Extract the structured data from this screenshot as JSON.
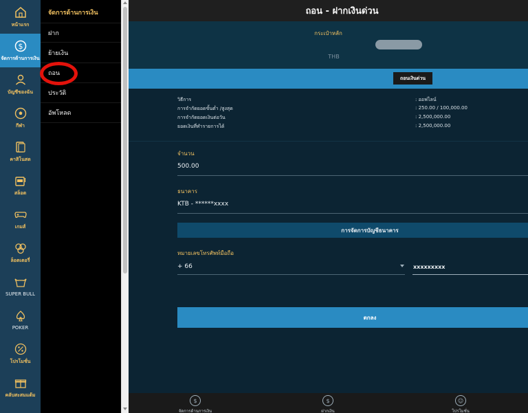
{
  "rail": {
    "items": [
      {
        "label": "หน้าแรก",
        "icon": "home-icon"
      },
      {
        "label": "จัดการด้านการเงิน",
        "icon": "dollar-circle-icon"
      },
      {
        "label": "บัญชีของฉัน",
        "icon": "user-icon"
      },
      {
        "label": "กีฬา",
        "icon": "soccer-ball-icon"
      },
      {
        "label": "คาสิโนสด",
        "icon": "cards-icon"
      },
      {
        "label": "สล็อต",
        "icon": "slot-machine-icon"
      },
      {
        "label": "เกมส์",
        "icon": "gamepad-icon"
      },
      {
        "label": "ล็อตเตอรี่",
        "icon": "lottery-balls-icon"
      },
      {
        "label": "SUPER BULL",
        "icon": "bull-icon"
      },
      {
        "label": "POKER",
        "icon": "spade-icon"
      },
      {
        "label": "โปรโมชั่น",
        "icon": "percent-icon"
      },
      {
        "label": "คลับสะสมแต้ม",
        "icon": "gift-icon"
      }
    ]
  },
  "submenu": {
    "title": "จัดการด้านการเงิน",
    "items": [
      "ฝาก",
      "ย้ายเงิน",
      "ถอน",
      "ประวัติ",
      "อัพโหลด"
    ]
  },
  "header": {
    "title": "ถอน - ฝากเงินด่วน"
  },
  "wallet": {
    "title": "กระเป๋าหลัก",
    "currency": "THB"
  },
  "instant_button": "ถอนเงินด่วน",
  "info": {
    "rows": [
      {
        "key": "วิธีการ",
        "value": ": ออฟไลน์"
      },
      {
        "key": "การจำกัดยอดขั้นต่ำ /สูงสุด",
        "value": ": 250.00 / 100,000.00"
      },
      {
        "key": "การจำกัดยอดเงินต่อวัน",
        "value": ": 2,500,000.00"
      },
      {
        "key": "ยอดเงินที่ทำรายการได้",
        "value": ": 2,500,000.00"
      }
    ]
  },
  "amount": {
    "label": "จำนวน",
    "value": "500.00"
  },
  "bank": {
    "label": "ธนาคาร",
    "value": "KTB - ******xxxx"
  },
  "bank_management": "การจัดการบัญชีธนาคาร",
  "phone": {
    "label": "หมายเลขโทรศัพท์มือถือ",
    "country_code": "+ 66",
    "number": "xxxxxxxxx"
  },
  "confirm_button": "ตกลง",
  "bottom_nav": [
    {
      "label": "จัดการด้านการเงิน",
      "icon": "dollar-circle-icon"
    },
    {
      "label": "ฝากเงิน",
      "icon": "dollar-circle-icon"
    },
    {
      "label": "โปรโมชั่น",
      "icon": "user-circle-icon"
    }
  ],
  "colors": {
    "accent": "#2a8bc2",
    "gold": "#f0c060",
    "highlight_ring": "#e3120b",
    "background": "#0c2433"
  }
}
